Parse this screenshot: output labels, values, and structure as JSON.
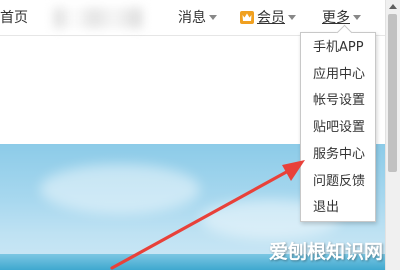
{
  "topbar": {
    "home": "首页",
    "notifications": "消息",
    "member": "会员",
    "more": "更多"
  },
  "dropdown": {
    "items": [
      "手机APP",
      "应用中心",
      "帐号设置",
      "贴吧设置",
      "服务中心",
      "问题反馈",
      "退出"
    ]
  },
  "watermark": "爱刨根知识网",
  "colors": {
    "annotation_arrow": "#e8413a",
    "sky": "#a8d8ef",
    "vip_icon": "#f0a020"
  },
  "icons": {
    "member": "vip-crown-icon",
    "caret": "caret-down-icon"
  }
}
